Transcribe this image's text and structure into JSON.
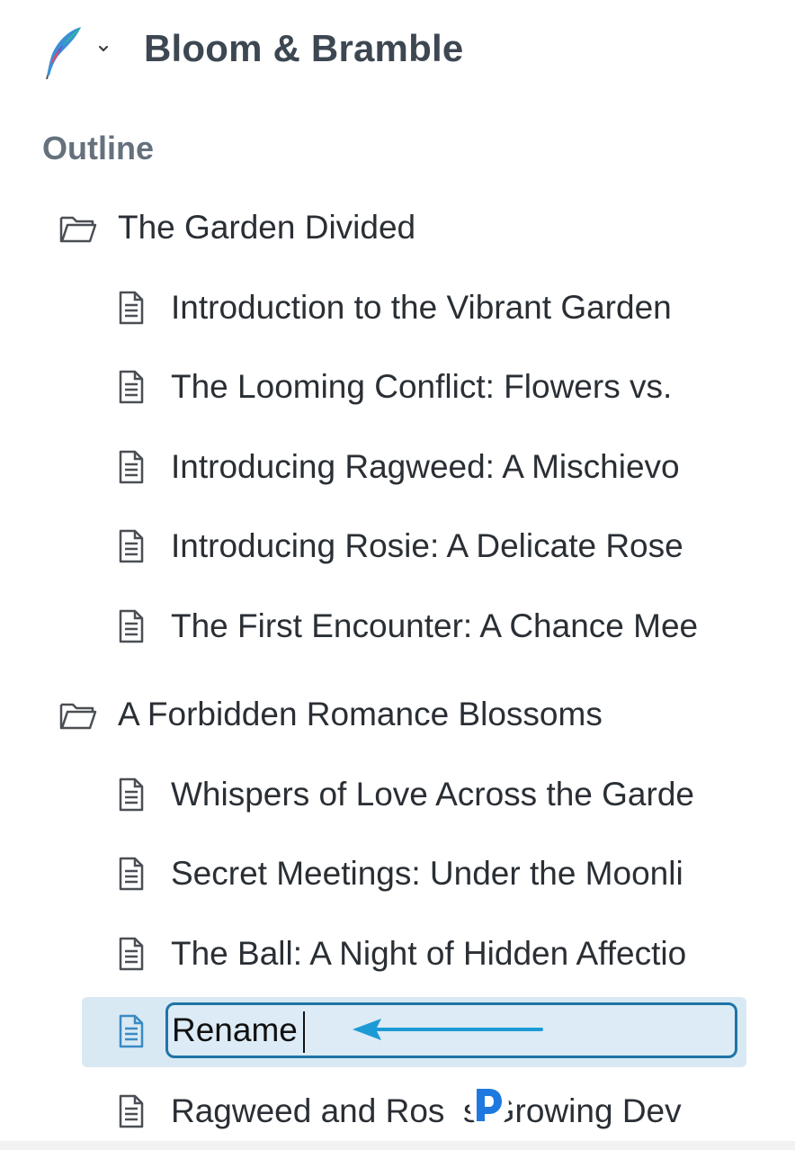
{
  "app": {
    "title": "Bloom & Bramble"
  },
  "outline": {
    "label": "Outline"
  },
  "folders": [
    {
      "title": "The Garden Divided",
      "items": [
        "Introduction to the Vibrant Garden",
        "The Looming Conflict: Flowers vs.",
        "Introducing Ragweed: A Mischievo",
        "Introducing Rosie: A Delicate Rose",
        "The First Encounter: A Chance Mee"
      ]
    },
    {
      "title": "A Forbidden Romance Blossoms",
      "items": [
        "Whispers of Love Across the Garde",
        "Secret Meetings: Under the Moonli",
        "The Ball: A Night of Hidden Affectio"
      ]
    }
  ],
  "rename": {
    "value": "Rename"
  },
  "last_item": "Ragweed and Ros  s Growing Dev",
  "colors": {
    "accent": "#1f74a6",
    "selection": "#d9e9f4",
    "arrow": "#1c9ad6"
  },
  "icons": {
    "logo": "quill-feather-icon",
    "dropdown": "chevron-down-icon",
    "folder": "folder-icon",
    "document": "document-icon",
    "arrow": "arrow-left-icon",
    "cursor": "pointer-badge-icon"
  }
}
